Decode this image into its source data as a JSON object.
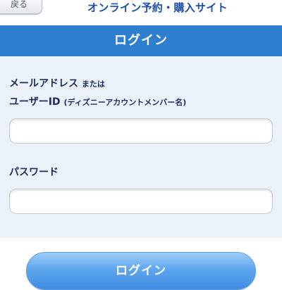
{
  "topbar": {
    "back_label": "戻る",
    "site_title": "オンライン予約・購入サイト"
  },
  "header": {
    "title": "ログイン"
  },
  "form": {
    "email_label_main": "メールアドレス",
    "email_label_or": "または",
    "userid_label_main": "ユーザーID",
    "userid_label_note": "(ディズニーアカウントメンバー名)",
    "email_value": "",
    "password_label": "パスワード",
    "password_value": ""
  },
  "actions": {
    "login_label": "ログイン"
  },
  "colors": {
    "header": "#2f7fd0",
    "panel": "#eaf1f8",
    "label_text": "#1a2d5a",
    "title_text": "#1c4fa8"
  }
}
